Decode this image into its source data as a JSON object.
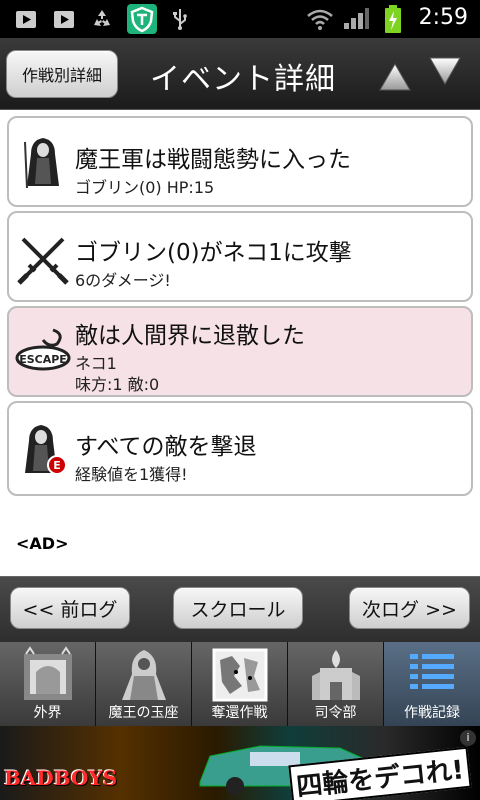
{
  "status_bar": {
    "time": "2:59",
    "icons": [
      "youtube-icon",
      "youtube-icon",
      "recycle-icon",
      "shield-app-icon",
      "usb-icon",
      "wifi-icon",
      "signal-icon",
      "battery-charging-icon"
    ]
  },
  "header": {
    "mode_button": "作戦別詳細",
    "title": "イベント詳細",
    "up_icon": "arrow-up-icon",
    "down_icon": "arrow-down-icon"
  },
  "events": [
    {
      "icon": "reaper-icon",
      "title": "魔王軍は戦闘態勢に入った",
      "line1": "ゴブリン(0) HP:15",
      "line2": ""
    },
    {
      "icon": "crossed-swords-icon",
      "title": "ゴブリン(0)がネコ1に攻撃",
      "line1": "6のダメージ!",
      "line2": ""
    },
    {
      "icon": "escape-icon",
      "title": "敵は人間界に退散した",
      "line1": "ネコ1",
      "line2": "味方:1 敵:0",
      "badge": "ESCAPE"
    },
    {
      "icon": "reaper-e-icon",
      "title": "すべての敵を撃退",
      "line1": "経験値を1獲得!",
      "line2": "",
      "badge": "E"
    }
  ],
  "ad_label": "<AD>",
  "nav": {
    "prev": "<< 前ログ",
    "scroll": "スクロール",
    "next": "次ログ >>"
  },
  "tabs": [
    {
      "label": "外界",
      "active": false
    },
    {
      "label": "魔王の玉座",
      "active": false
    },
    {
      "label": "奪還作戦",
      "active": false
    },
    {
      "label": "司令部",
      "active": false
    },
    {
      "label": "作戦記録",
      "active": true
    }
  ],
  "banner": {
    "logo": "BADBOYS",
    "slogan": "四輪をデコれ!",
    "close": "i"
  },
  "colors": {
    "highlight_card": "#f6e1e6",
    "active_tab": "#4a5e74",
    "battery": "#7fd321"
  }
}
